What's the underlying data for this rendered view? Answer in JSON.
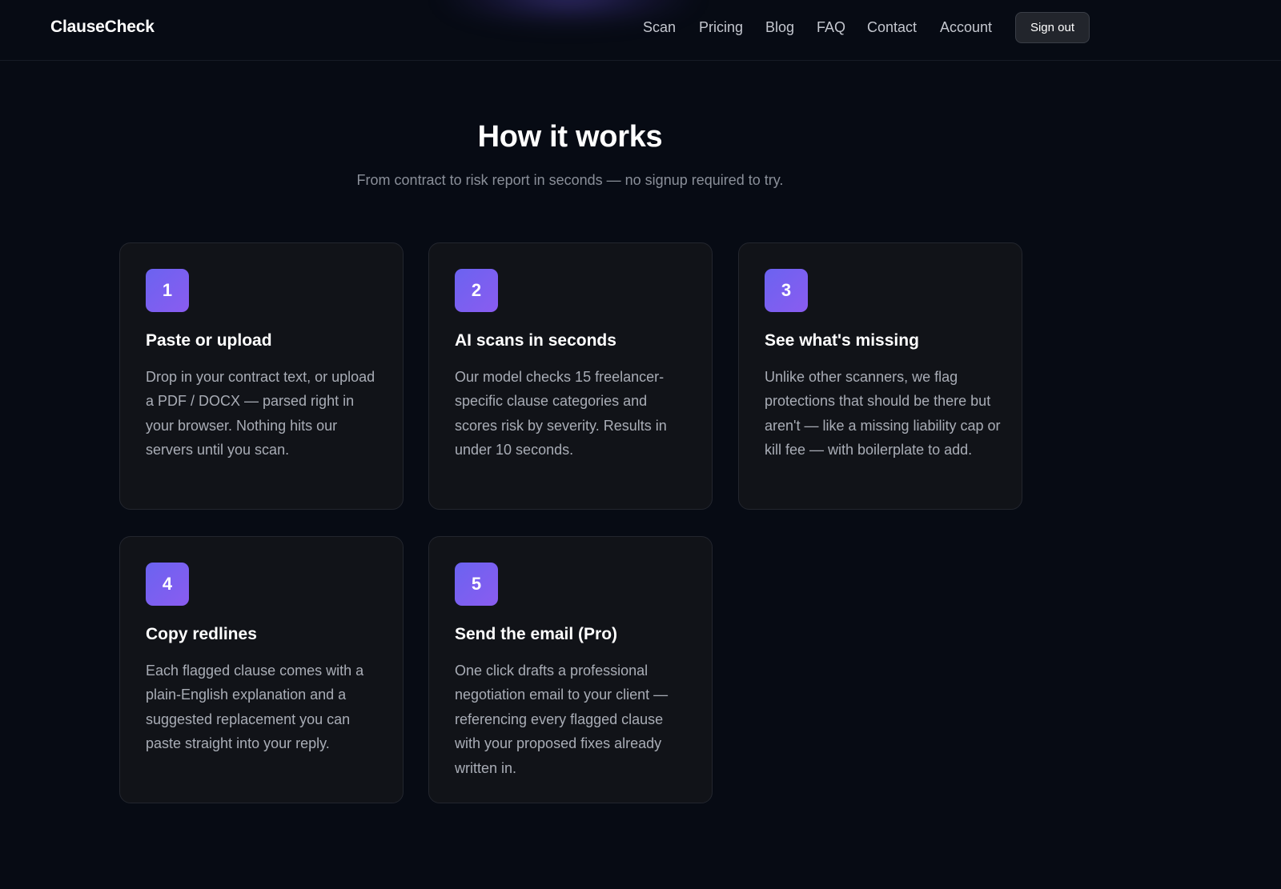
{
  "header": {
    "brand": "ClauseCheck",
    "nav": [
      {
        "label": "Scan"
      },
      {
        "label": "Pricing"
      },
      {
        "label": "Blog"
      },
      {
        "label": "FAQ"
      },
      {
        "label": "Contact"
      },
      {
        "label": "Account"
      }
    ],
    "sign_out_label": "Sign out"
  },
  "hero": {
    "title": "How it works",
    "subtitle": "From contract to risk report in seconds — no signup required to try."
  },
  "steps": [
    {
      "number": "1",
      "title": "Paste or upload",
      "body": "Drop in your contract text, or upload a PDF / DOCX — parsed right in your browser. Nothing hits our servers until you scan."
    },
    {
      "number": "2",
      "title": "AI scans in seconds",
      "body": "Our model checks 15 freelancer-specific clause categories and scores risk by severity. Results in under 10 seconds."
    },
    {
      "number": "3",
      "title": "See what's missing",
      "body": "Unlike other scanners, we flag protections that should be there but aren't — like a missing liability cap or kill fee — with boilerplate to add."
    },
    {
      "number": "4",
      "title": "Copy redlines",
      "body": "Each flagged clause comes with a plain-English explanation and a suggested replacement you can paste straight into your reply."
    },
    {
      "number": "5",
      "title": "Send the email (Pro)",
      "body": "One click drafts a professional negotiation email to your client — referencing every flagged clause with your proposed fixes already written in."
    }
  ],
  "colors": {
    "background": "#070b14",
    "card": "#111318",
    "accent_start": "#6b63f0",
    "accent_end": "#8a5cf0"
  }
}
